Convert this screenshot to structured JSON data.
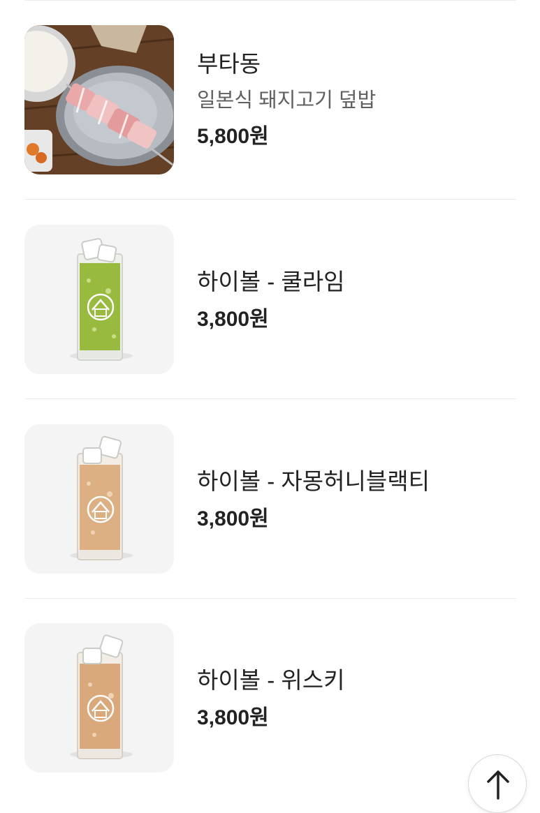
{
  "menu": {
    "items": [
      {
        "name": "부타동",
        "description": "일본식 돼지고기 덮밥",
        "price": "5,800원",
        "image_icon": "butadon-photo"
      },
      {
        "name": "하이볼 - 쿨라임",
        "price": "3,800원",
        "image_icon": "highball-glass-green"
      },
      {
        "name": "하이볼 - 자몽허니블랙티",
        "price": "3,800원",
        "image_icon": "highball-glass-amber"
      },
      {
        "name": "하이볼 - 위스키",
        "price": "3,800원",
        "image_icon": "highball-glass-amber"
      }
    ]
  },
  "colors": {
    "divider": "#ececec",
    "text_primary": "#222222",
    "text_secondary": "#606060",
    "lime_drink": "#8fb53a",
    "amber_drink": "#d8a87a"
  },
  "scroll_top": {
    "icon": "arrow-up-icon"
  }
}
